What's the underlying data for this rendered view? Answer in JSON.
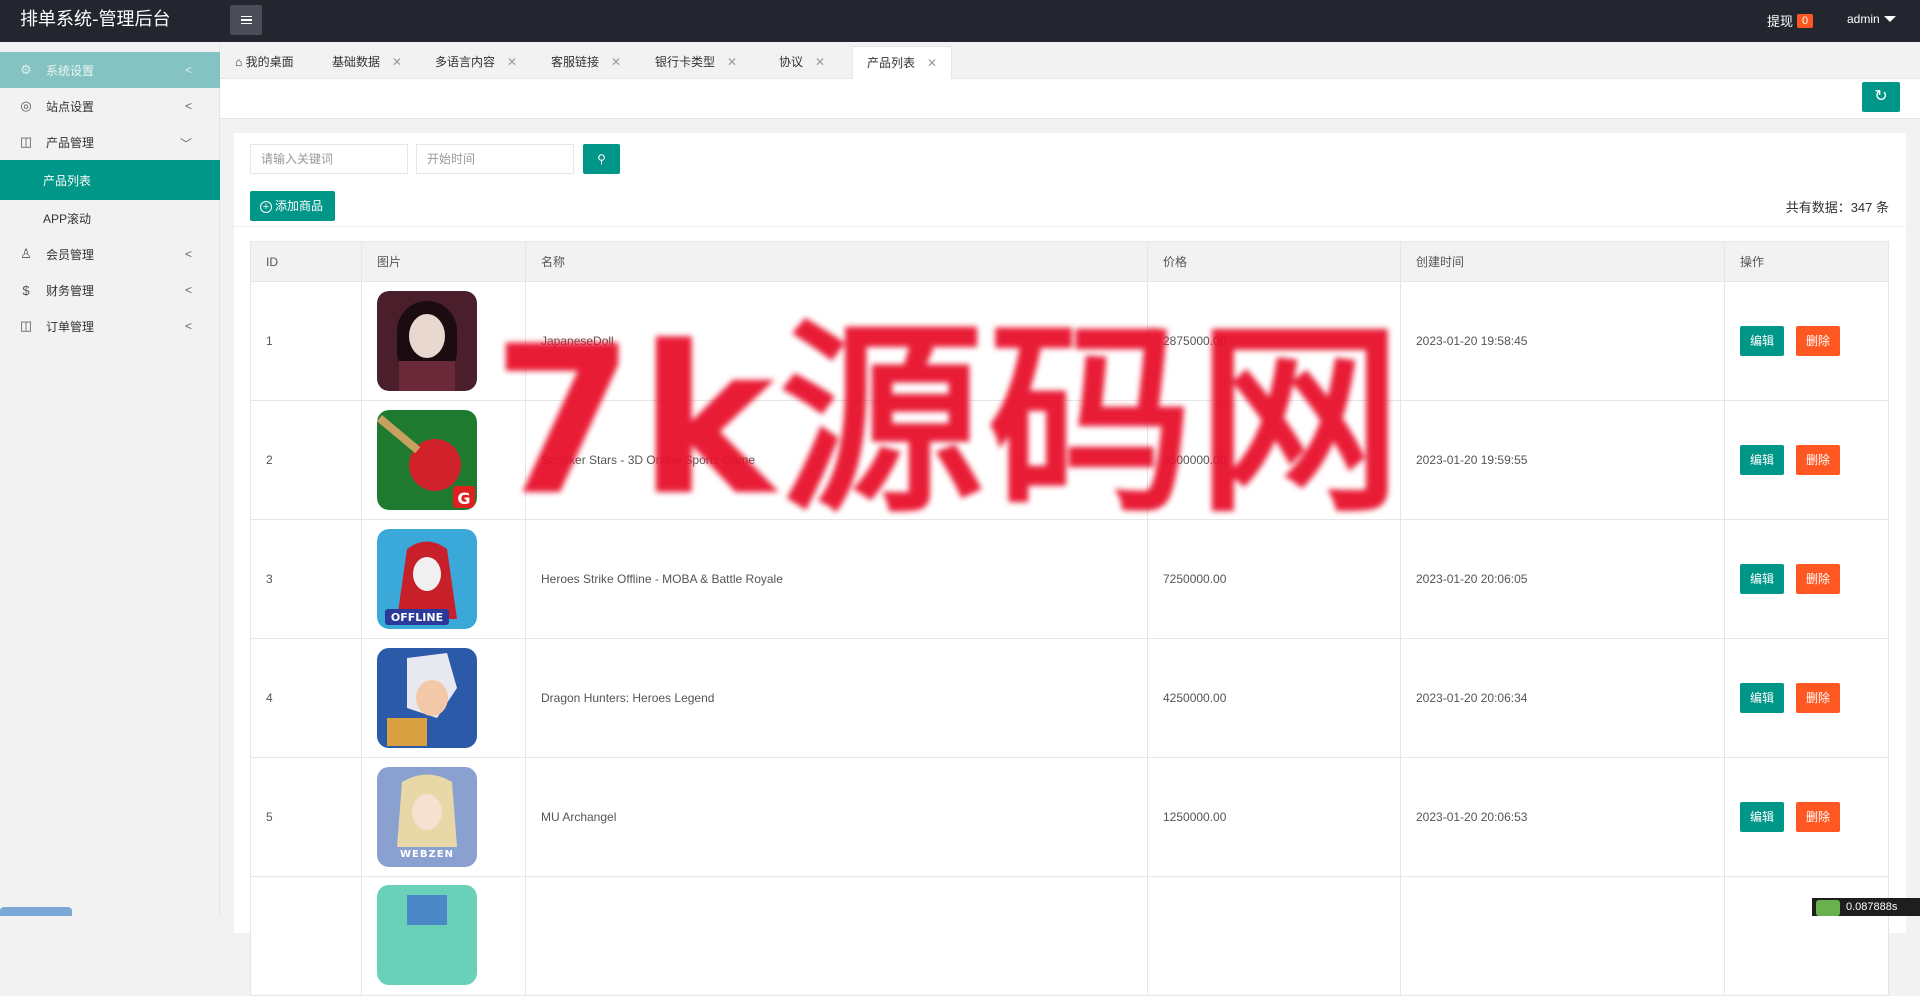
{
  "app": {
    "title": "排单系统-管理后台"
  },
  "header": {
    "withdraw_label": "提现",
    "withdraw_count": "0",
    "user": "admin"
  },
  "sidebar": {
    "items": [
      {
        "label": "系统设置",
        "icon": "gear-icon"
      },
      {
        "label": "站点设置",
        "icon": "globe-icon"
      },
      {
        "label": "产品管理",
        "icon": "box-icon"
      },
      {
        "label": "产品列表"
      },
      {
        "label": "APP滚动"
      },
      {
        "label": "会员管理",
        "icon": "user-icon"
      },
      {
        "label": "财务管理",
        "icon": "dollar-icon"
      },
      {
        "label": "订单管理",
        "icon": "box-icon"
      }
    ]
  },
  "tabs": [
    {
      "label": "我的桌面",
      "icon": "home-icon"
    },
    {
      "label": "基础数据"
    },
    {
      "label": "多语言内容"
    },
    {
      "label": "客服链接"
    },
    {
      "label": "银行卡类型"
    },
    {
      "label": "协议"
    },
    {
      "label": "产品列表",
      "active": true
    }
  ],
  "search": {
    "keyword_placeholder": "请输入关键词",
    "date_placeholder": "开始时间"
  },
  "toolbar": {
    "add_label": "添加商品",
    "total_text": "共有数据：347 条"
  },
  "table": {
    "headers": [
      "ID",
      "图片",
      "名称",
      "价格",
      "创建时间",
      "操作"
    ],
    "edit_label": "编辑",
    "delete_label": "删除",
    "rows": [
      {
        "id": "1",
        "name": "JapaneseDoll",
        "price": "2875000.00",
        "created": "2023-01-20 19:58:45"
      },
      {
        "id": "2",
        "name": "Snooker Stars - 3D Online Sports Game",
        "price": "3500000.00",
        "created": "2023-01-20 19:59:55"
      },
      {
        "id": "3",
        "name": "Heroes Strike Offline - MOBA & Battle Royale",
        "price": "7250000.00",
        "created": "2023-01-20 20:06:05"
      },
      {
        "id": "4",
        "name": "Dragon Hunters: Heroes Legend",
        "price": "4250000.00",
        "created": "2023-01-20 20:06:34"
      },
      {
        "id": "5",
        "name": "MU Archangel",
        "price": "1250000.00",
        "created": "2023-01-20 20:06:53"
      },
      {
        "id": "",
        "name": "",
        "price": "",
        "created": ""
      }
    ]
  },
  "watermark": "7k源码网",
  "footer": {
    "corner_text": "0.087888s"
  },
  "colors": {
    "accent": "#009688",
    "danger": "#ff5722",
    "topbar": "#23262e"
  }
}
